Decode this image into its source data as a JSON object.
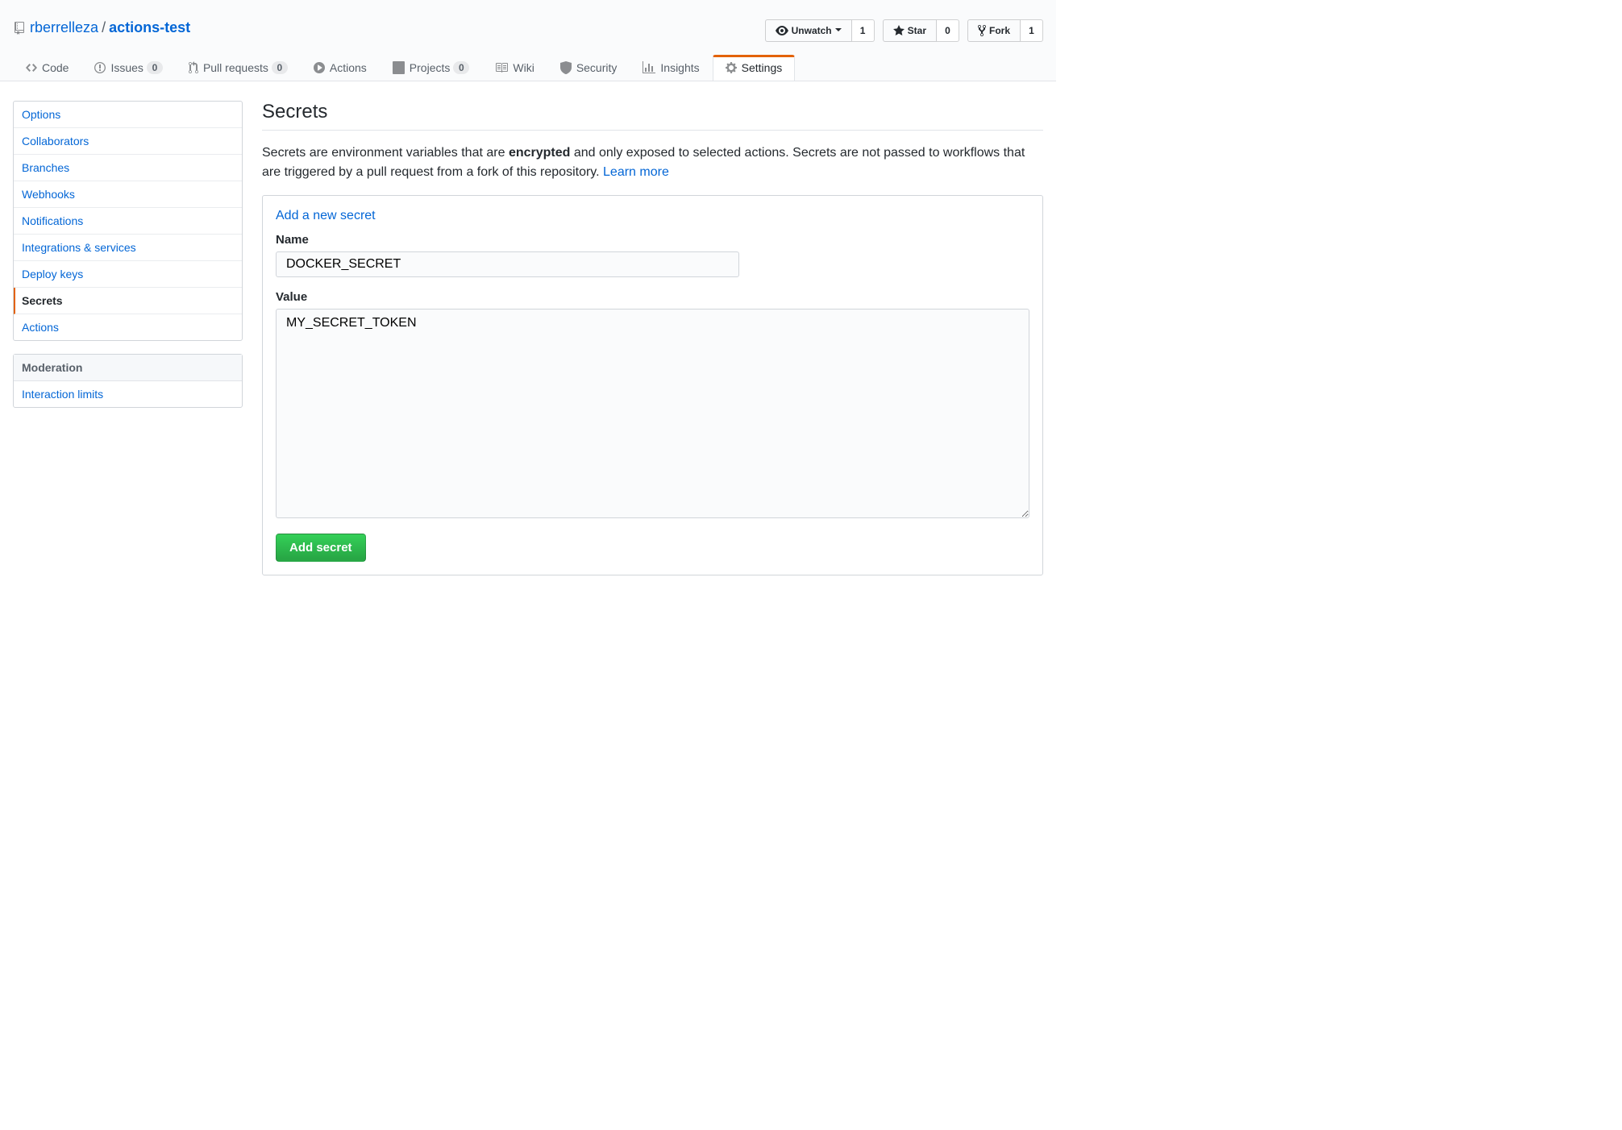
{
  "repo": {
    "owner": "rberrelleza",
    "name": "actions-test",
    "watch_label": "Unwatch",
    "watch_count": "1",
    "star_label": "Star",
    "star_count": "0",
    "fork_label": "Fork",
    "fork_count": "1"
  },
  "tabs": {
    "code": "Code",
    "issues": "Issues",
    "issues_count": "0",
    "pulls": "Pull requests",
    "pulls_count": "0",
    "actions": "Actions",
    "projects": "Projects",
    "projects_count": "0",
    "wiki": "Wiki",
    "security": "Security",
    "insights": "Insights",
    "settings": "Settings"
  },
  "sidebar": {
    "items": [
      "Options",
      "Collaborators",
      "Branches",
      "Webhooks",
      "Notifications",
      "Integrations & services",
      "Deploy keys",
      "Secrets",
      "Actions"
    ],
    "moderation_heading": "Moderation",
    "interaction_limits": "Interaction limits"
  },
  "page": {
    "title": "Secrets",
    "intro_pre": "Secrets are environment variables that are ",
    "intro_bold": "encrypted",
    "intro_post": " and only exposed to selected actions. Secrets are not passed to workflows that are triggered by a pull request from a fork of this repository. ",
    "learn_more": "Learn more",
    "add_heading": "Add a new secret",
    "name_label": "Name",
    "name_value": "DOCKER_SECRET",
    "value_label": "Value",
    "value_value": "MY_SECRET_TOKEN",
    "submit_label": "Add secret"
  }
}
